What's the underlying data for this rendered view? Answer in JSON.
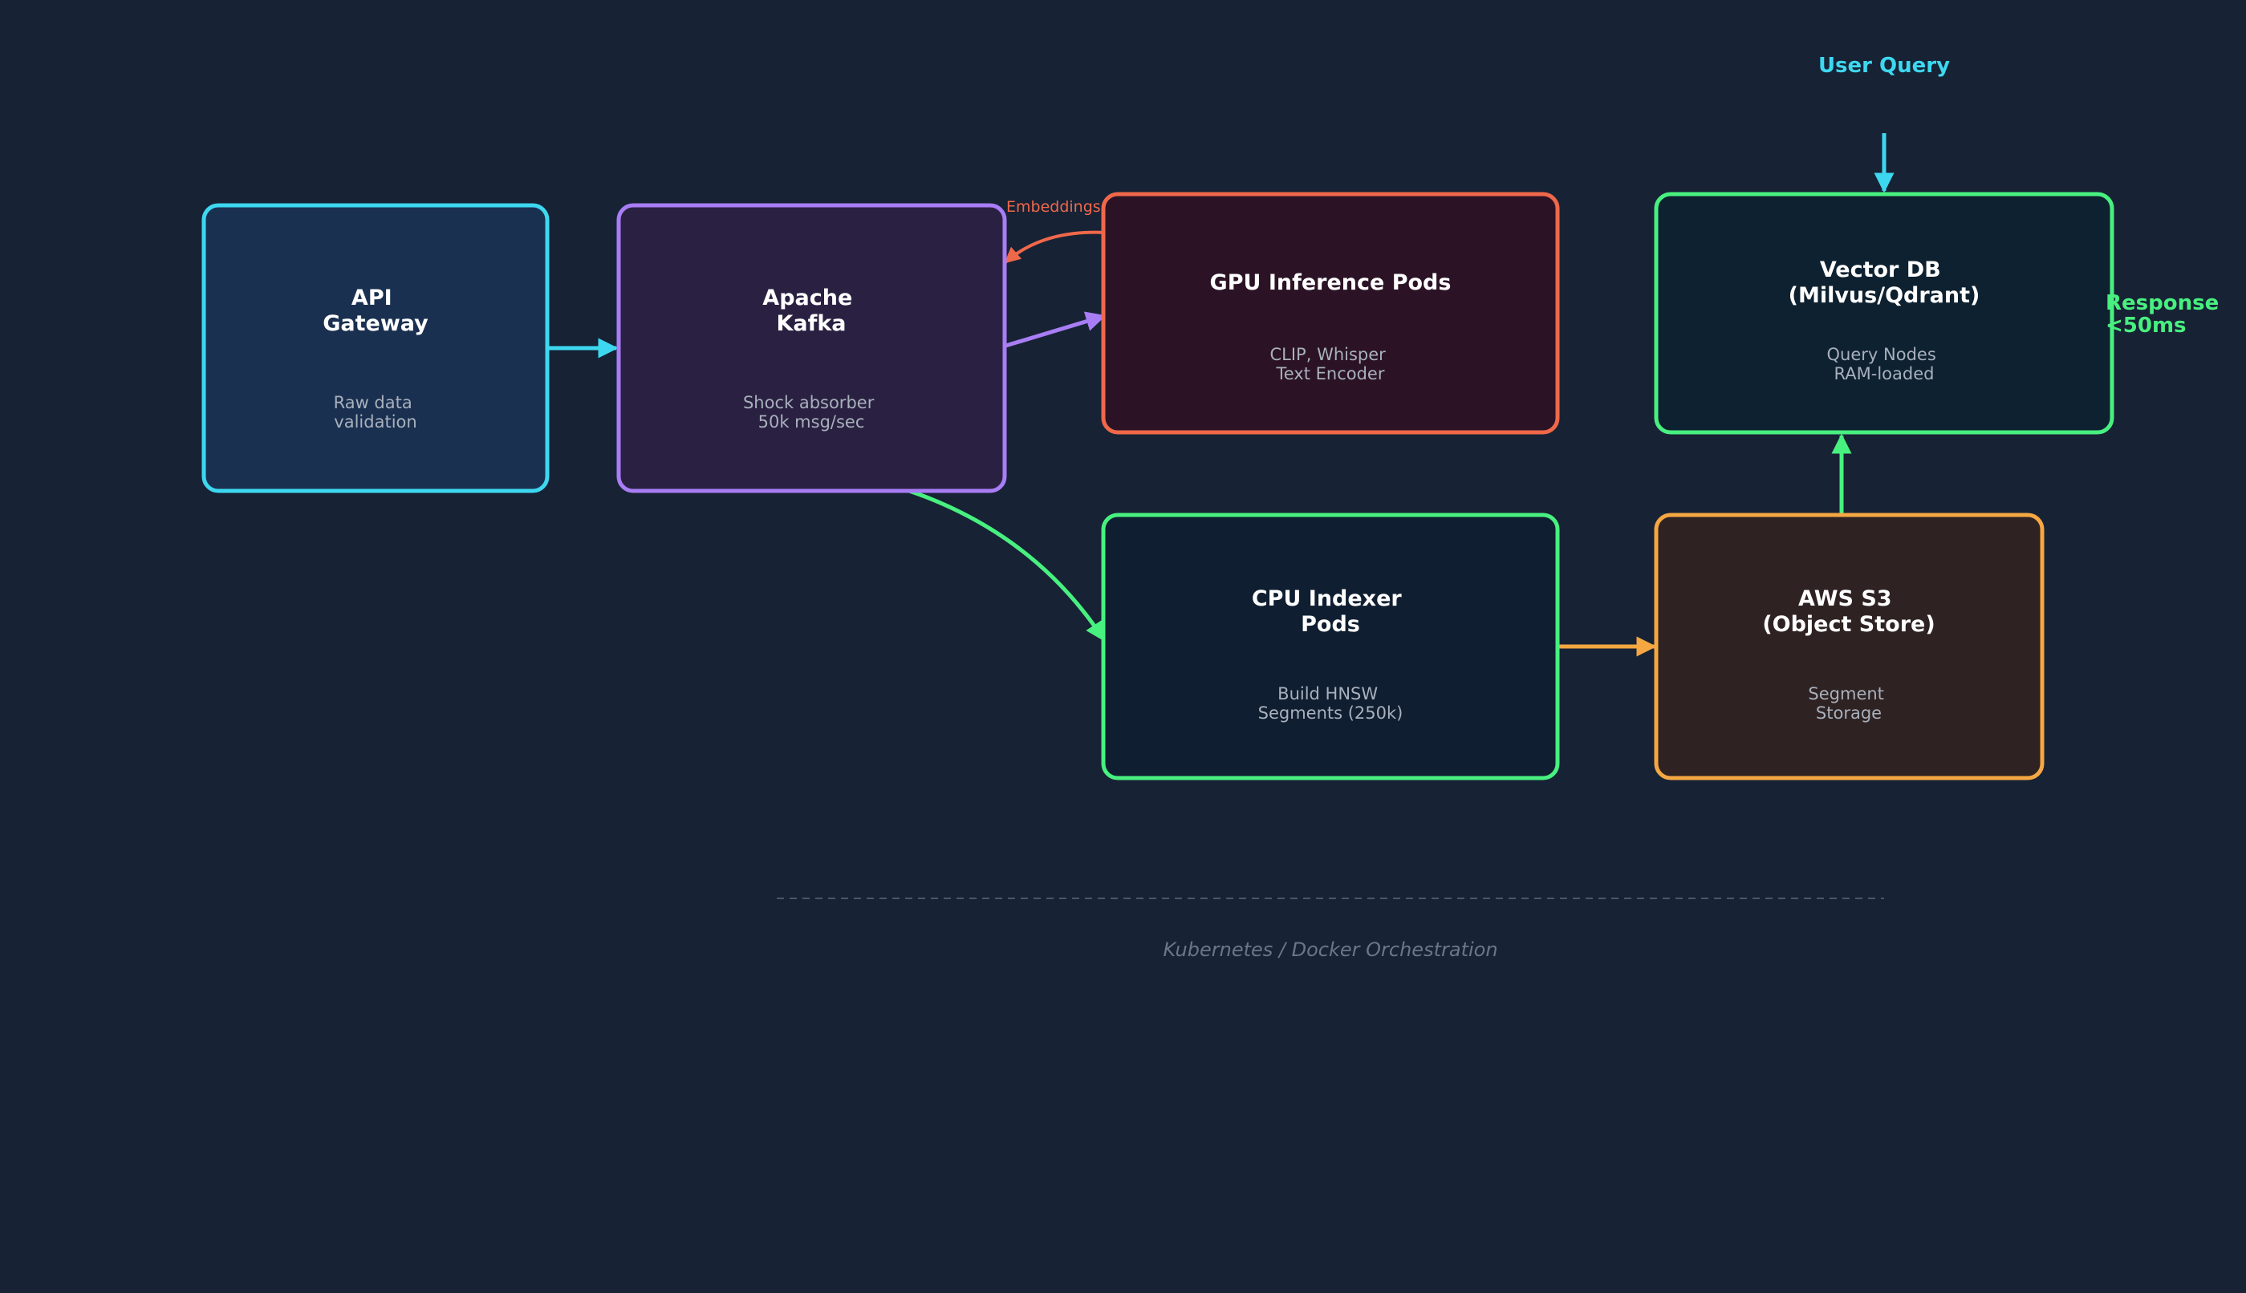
{
  "colors": {
    "background": "#172235",
    "cyan": "#3dd8f0",
    "purple": "#a87df5",
    "red": "#f0684a",
    "green": "#48f07f",
    "orange": "#f5a742",
    "muted": "#6b7686"
  },
  "nodes": {
    "api_gateway": {
      "title": [
        "API",
        "Gateway"
      ],
      "subtitle": [
        "Raw data",
        "validation"
      ]
    },
    "kafka": {
      "title": [
        "Apache",
        "Kafka"
      ],
      "subtitle": [
        "Shock absorber",
        "50k msg/sec"
      ]
    },
    "gpu": {
      "title": [
        "GPU Inference Pods"
      ],
      "subtitle": [
        "CLIP, Whisper",
        "Text Encoder"
      ]
    },
    "vectordb": {
      "title": [
        "Vector DB",
        "(Milvus/Qdrant)"
      ],
      "subtitle": [
        "Query Nodes",
        "RAM-loaded"
      ]
    },
    "cpu": {
      "title": [
        "CPU Indexer",
        "Pods"
      ],
      "subtitle": [
        "Build HNSW",
        "Segments (250k)"
      ]
    },
    "s3": {
      "title": [
        "AWS S3",
        "(Object Store)"
      ],
      "subtitle": [
        "Segment",
        "Storage"
      ]
    }
  },
  "labels": {
    "user_query": "User Query",
    "response": [
      "Response",
      "<50ms"
    ],
    "embeddings": "Embeddings",
    "orchestration": "Kubernetes / Docker Orchestration"
  }
}
